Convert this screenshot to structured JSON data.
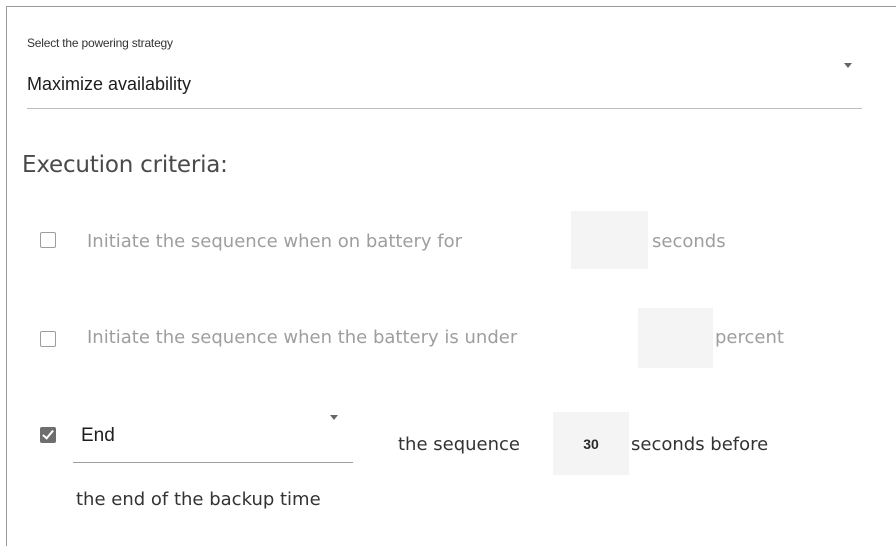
{
  "strategy": {
    "label": "Select the powering strategy",
    "value": "Maximize availability",
    "dropdown_icon": "chevron-down-icon"
  },
  "execution": {
    "title": "Execution criteria:",
    "criteria": [
      {
        "checked": false,
        "enabled": false,
        "text_before": "Initiate  the sequence when on battery for",
        "value": "",
        "text_after": "seconds"
      },
      {
        "checked": false,
        "enabled": false,
        "text_before": "Initiate the sequence when the battery is under",
        "value": "",
        "text_after": "percent"
      },
      {
        "checked": true,
        "enabled": true,
        "select_value": "End",
        "text_before": "the sequence",
        "value": "30",
        "text_after": "seconds before",
        "text_continued": "the end of the backup time"
      }
    ]
  },
  "colors": {
    "checked_box": "#6e6e6e",
    "disabled_text": "#9e9e9e",
    "input_background": "#f4f4f4"
  }
}
